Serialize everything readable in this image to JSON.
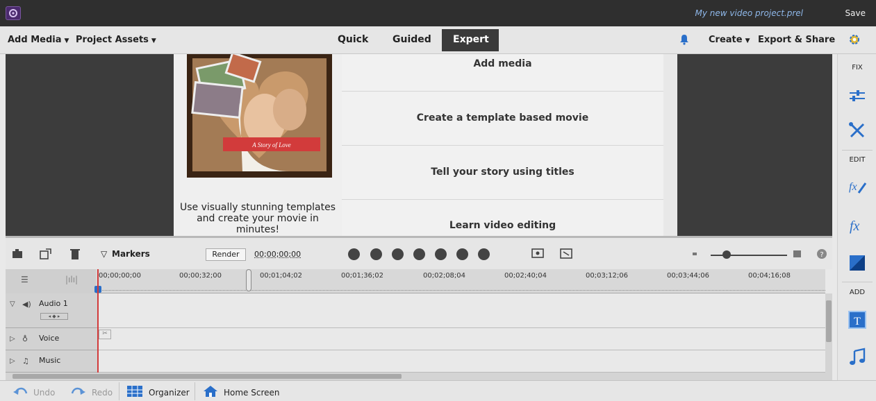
{
  "titlebar": {
    "project_title": "My new video project.prel",
    "save_label": "Save"
  },
  "menubar": {
    "add_media": "Add Media",
    "project_assets": "Project Assets",
    "tabs": [
      "Quick",
      "Guided",
      "Expert"
    ],
    "active_tab": "Expert",
    "create": "Create",
    "export_share": "Export & Share"
  },
  "welcome": {
    "tagline": "Use visually stunning templates and create your movie in minutes!",
    "options": [
      "Add media",
      "Create a template based movie",
      "Tell your story using titles",
      "Learn video editing"
    ]
  },
  "right_panel": {
    "fix_label": "FIX",
    "edit_label": "EDIT",
    "add_label": "ADD"
  },
  "timeline_toolbar": {
    "markers_label": "Markers",
    "render_label": "Render",
    "timecode": "00;00;00;00"
  },
  "ruler": {
    "ticks": [
      "00;00;00;00",
      "00;00;32;00",
      "00;01;04;02",
      "00;01;36;02",
      "00;02;08;04",
      "00;02;40;04",
      "00;03;12;06",
      "00;03;44;06",
      "00;04;16;08"
    ]
  },
  "tracks": [
    {
      "name": "Audio 1",
      "icon": "speaker-icon",
      "expanded": true
    },
    {
      "name": "Voice",
      "icon": "microphone-icon",
      "expanded": false
    },
    {
      "name": "Music",
      "icon": "music-note-icon",
      "expanded": false
    }
  ],
  "bottombar": {
    "undo": "Undo",
    "redo": "Redo",
    "organizer": "Organizer",
    "home_screen": "Home Screen"
  },
  "colors": {
    "accent_blue": "#2a6fc9",
    "title_bar": "#2f2f2f",
    "playhead": "#d23b3b",
    "expert_tab": "#3a3a3a"
  }
}
